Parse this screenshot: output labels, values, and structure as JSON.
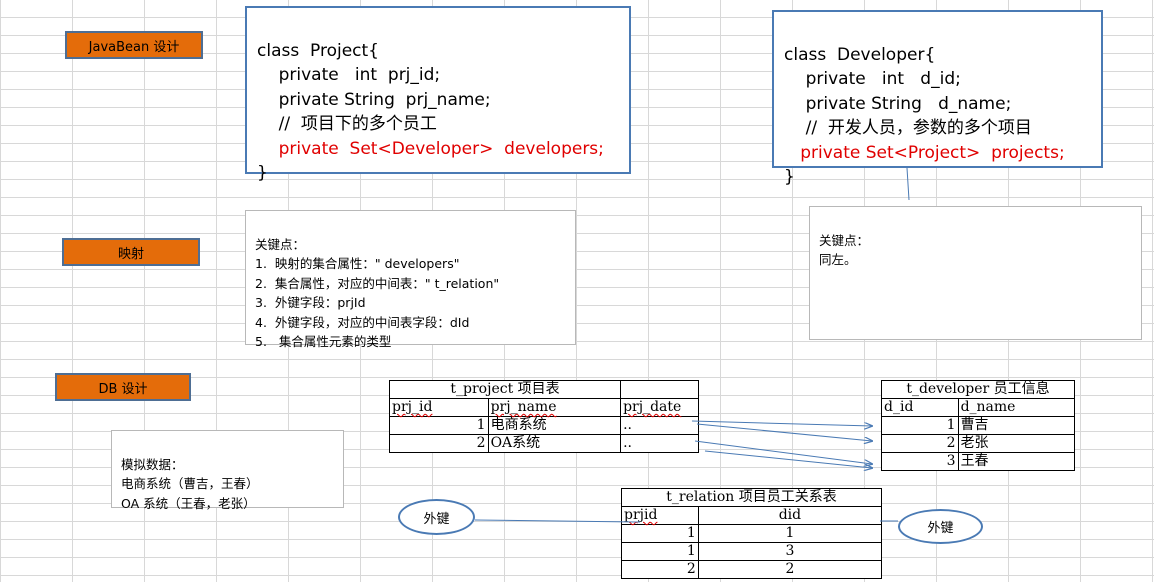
{
  "tags": {
    "javabean": "JavaBean 设计",
    "mapping": "映射",
    "db": "DB 设计"
  },
  "project_class": {
    "line1": "class  Project{",
    "line2": "    private   int  prj_id;",
    "line3": "    private String  prj_name;",
    "line4": "    //  项目下的多个员工",
    "line5": "    private  Set<Developer>  developers;",
    "line6": "}"
  },
  "developer_class": {
    "line1": "class  Developer{",
    "line2": "    private   int   d_id;",
    "line3": "    private String   d_name;",
    "line4": "    //  开发人员，参数的多个项目",
    "line5": "   private Set<Project>  projects;",
    "line6": "}"
  },
  "key_points_left": {
    "title": "关键点：",
    "items": [
      "1.  映射的集合属性：\" developers\"",
      "2.  集合属性，对应的中间表：\" t_relation\"",
      "3.  外键字段：prjId",
      "4.  外键字段，对应的中间表字段：dId",
      "5.   集合属性元素的类型"
    ]
  },
  "key_points_right": {
    "title": "关键点：",
    "text": "同左。"
  },
  "mock_data": {
    "title": "模拟数据：",
    "line1": "电商系统（曹吉，王春）",
    "line2": "OA 系统（王春，老张）"
  },
  "t_project": {
    "title": "t_project 项目表",
    "headers": [
      "prj_id",
      "prj_name",
      "prj_date"
    ],
    "rows": [
      [
        "1",
        "电商系统",
        ".."
      ],
      [
        "2",
        "OA系统",
        ".."
      ]
    ]
  },
  "t_developer": {
    "title": "t_developer 员工信息",
    "headers": [
      "d_id",
      "d_name"
    ],
    "rows": [
      [
        "1",
        "曹吉"
      ],
      [
        "2",
        "老张"
      ],
      [
        "3",
        "王春"
      ]
    ]
  },
  "t_relation": {
    "title": "t_relation 项目员工关系表",
    "headers": [
      "prjid",
      "did"
    ],
    "rows": [
      [
        "1",
        "1"
      ],
      [
        "1",
        "3"
      ],
      [
        "2",
        "2"
      ]
    ]
  },
  "foreign_key_left": "外键",
  "foreign_key_right": "外键",
  "colors": {
    "tag_fill": "#e46c0a",
    "box_border": "#4a7ab4",
    "highlight_text": "#e00000"
  }
}
